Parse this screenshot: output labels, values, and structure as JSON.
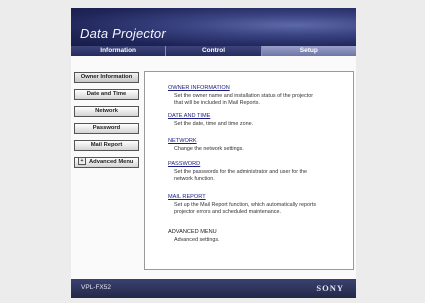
{
  "header": {
    "title": "Data Projector",
    "tabs": [
      {
        "label": "Information",
        "active": false
      },
      {
        "label": "Control",
        "active": false
      },
      {
        "label": "Setup",
        "active": true
      }
    ]
  },
  "menu": {
    "items": [
      {
        "label": "Owner Information"
      },
      {
        "label": "Date and Time"
      },
      {
        "label": "Network"
      },
      {
        "label": "Password"
      },
      {
        "label": "Mail Report"
      },
      {
        "label": "Advanced Menu",
        "expander": "+"
      }
    ]
  },
  "content": {
    "sections": [
      {
        "title": "OWNER INFORMATION",
        "desc_lines": [
          "Set the owner name and installation status of the projector",
          "that will be included in Mail Reports."
        ]
      },
      {
        "title": "DATE AND TIME",
        "desc_lines": [
          "Set the date, time and time zone."
        ]
      },
      {
        "title": "NETWORK",
        "desc_lines": [
          "Change the network settings."
        ]
      },
      {
        "title": "PASSWORD",
        "desc_lines": [
          "Set the passwords for the administrator and user for the",
          "network function."
        ]
      },
      {
        "title": "MAIL REPORT",
        "desc_lines": [
          "Set up the Mail Report function, which automatically reports",
          "projector errors and scheduled maintenance."
        ]
      },
      {
        "title": "ADVANCED MENU",
        "desc_lines": [
          "Advanced settings."
        ]
      }
    ]
  },
  "footer": {
    "model": "VPL-FX52",
    "brand": "SONY"
  },
  "colors": {
    "banner": "#2a3068",
    "active_tab": "#8c92c0",
    "link": "#1a1a80"
  }
}
